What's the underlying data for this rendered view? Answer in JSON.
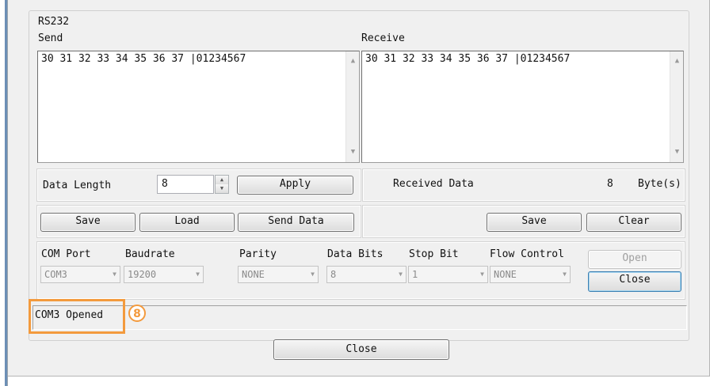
{
  "group": {
    "title": "RS232"
  },
  "send": {
    "label": "Send",
    "content": "30 31 32 33 34 35 36 37 |01234567"
  },
  "receive": {
    "label": "Receive",
    "content": "30 31 32 33 34 35 36 37 |01234567"
  },
  "data_length": {
    "label": "Data Length",
    "value": "8",
    "apply_label": "Apply"
  },
  "received": {
    "label": "Received Data",
    "count": "8",
    "unit": "Byte(s)"
  },
  "send_buttons": {
    "save": "Save",
    "load": "Load",
    "send_data": "Send Data"
  },
  "receive_buttons": {
    "save": "Save",
    "clear": "Clear"
  },
  "settings": {
    "com_port": {
      "label": "COM Port",
      "value": "COM3"
    },
    "baudrate": {
      "label": "Baudrate",
      "value": "19200"
    },
    "parity": {
      "label": "Parity",
      "value": "NONE"
    },
    "data_bits": {
      "label": "Data Bits",
      "value": "8"
    },
    "stop_bit": {
      "label": "Stop Bit",
      "value": "1"
    },
    "flow_control": {
      "label": "Flow Control",
      "value": "NONE"
    },
    "open_label": "Open",
    "close_label": "Close"
  },
  "status": {
    "text": "COM3 Opened",
    "badge": "8"
  },
  "footer": {
    "close_label": "Close"
  },
  "colors": {
    "highlight": "#f39a3d",
    "window_bg": "#f0f0f0",
    "accent_edge": "#6c8fb6"
  },
  "icons": {
    "scroll_up": "triangle-up",
    "scroll_down": "triangle-down",
    "dropdown": "chevron-down",
    "spin": "up-down-arrows"
  }
}
